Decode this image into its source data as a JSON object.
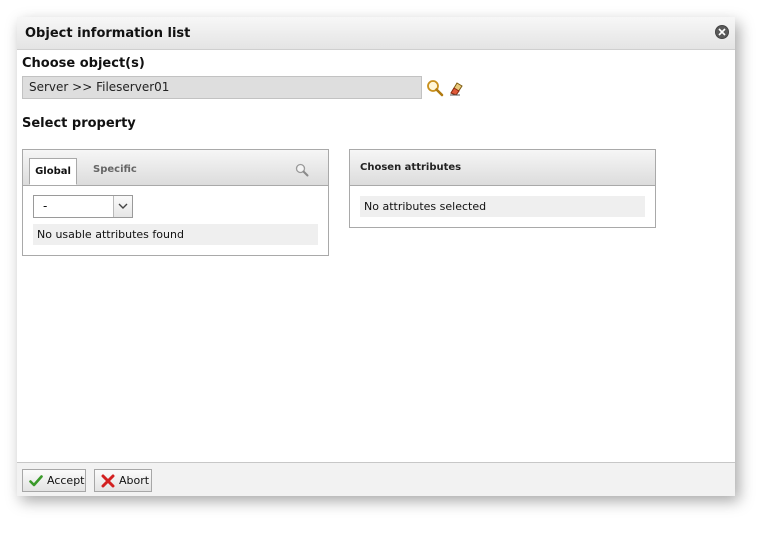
{
  "dialog": {
    "title": "Object information list"
  },
  "objects": {
    "label": "Choose object(s)",
    "value": "Server >> Fileserver01"
  },
  "property": {
    "label": "Select property",
    "tabs": [
      {
        "label": "Global",
        "active": true
      },
      {
        "label": "Specific",
        "active": false
      }
    ],
    "select_value": "-",
    "empty_message": "No usable attributes found"
  },
  "chosen": {
    "header": "Chosen attributes",
    "empty_message": "No attributes selected"
  },
  "footer": {
    "accept_label": "Accept",
    "abort_label": "Abort"
  },
  "colors": {
    "accept_icon": "#3a9a2a",
    "abort_icon": "#d32020",
    "search_icon": "#c8901e"
  }
}
